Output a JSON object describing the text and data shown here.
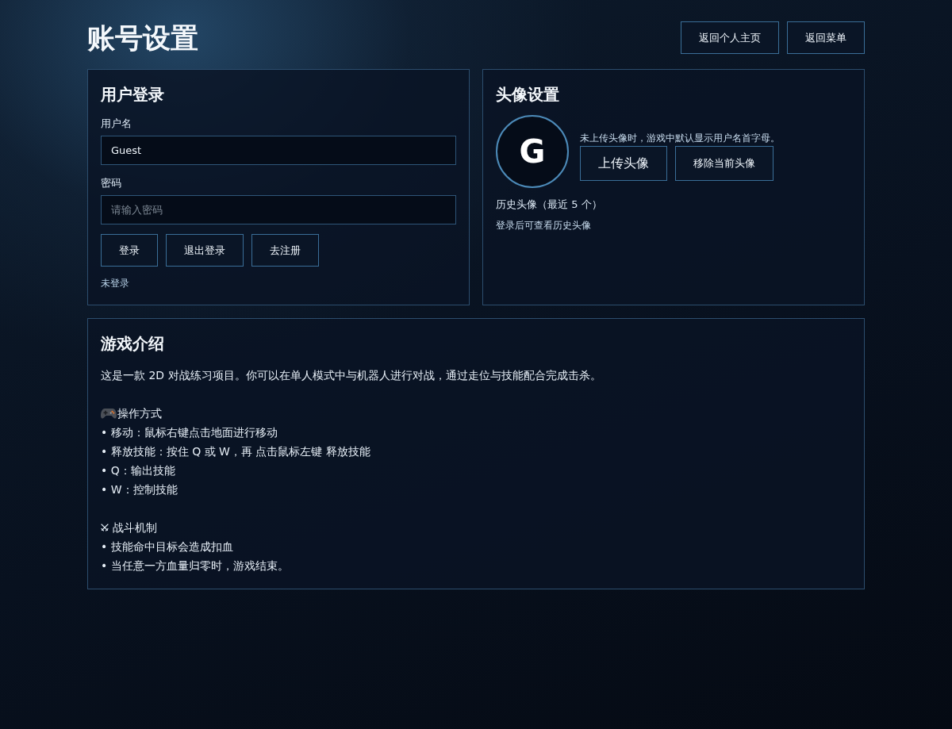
{
  "page": {
    "title": "账号设置"
  },
  "header_buttons": [
    "返回个人主页",
    "返回菜单"
  ],
  "login_card": {
    "title": "用户登录",
    "fields": [
      {
        "label": "用户名",
        "value": "Guest"
      },
      {
        "label": "密码",
        "placeholder": "请输入密码"
      }
    ],
    "buttons": [
      "登录",
      "退出登录",
      "去注册"
    ],
    "status": "未登录"
  },
  "avatar_card": {
    "title": "头像设置",
    "avatar_letter": "G",
    "hint": "未上传头像时，游戏中默认显示用户名首字母。",
    "buttons": [
      {
        "label": "上传头像",
        "kind": "upload"
      },
      {
        "label": "移除当前头像",
        "kind": "action"
      }
    ],
    "history_title": "历史头像（最近 5 个）",
    "history_note": "登录后可查看历史头像"
  },
  "intro_card": {
    "title": "游戏介绍",
    "paragraph": "这是一款 2D 对战练习项目。你可以在单人模式中与机器人进行对战，通过走位与技能配合完成击杀。",
    "sections": [
      {
        "kind": "controls",
        "heading": "操作方式",
        "items": [
          "• 移动：鼠标右键点击地面进行移动",
          "• 释放技能：按住 Q 或 W，再 点击鼠标左键 释放技能",
          "• Q：输出技能",
          "• W：控制技能"
        ]
      },
      {
        "kind": "combat",
        "heading": "战斗机制",
        "items": [
          "• 技能命中目标会造成扣血",
          "• 当任意一方血量归零时，游戏结束。"
        ]
      }
    ]
  }
}
